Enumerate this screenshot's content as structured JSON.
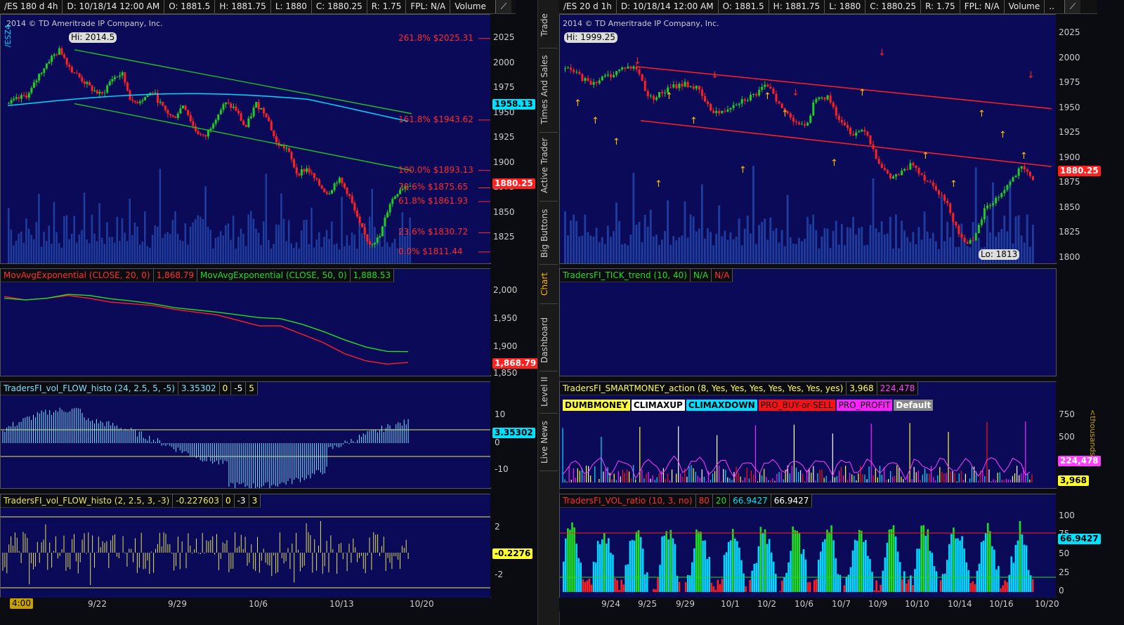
{
  "left": {
    "header": [
      "/ES 180 d 4h",
      "D: 10/18/14 12:00 AM",
      "O: 1881.5",
      "H: 1881.75",
      "L: 1880",
      "C: 1880.25",
      "R: 1.75",
      "FPL: N/A",
      "Volume",
      "..."
    ],
    "copyright": "2014 © TD Ameritrade IP Company, Inc.",
    "contract_label": "/ESZ4",
    "hi_label": "Hi: 2014.5",
    "price_ticks": [
      "2025",
      "2000",
      "1975",
      "1950",
      "1925",
      "1900",
      "1875",
      "1850",
      "1825"
    ],
    "price_badge": "1880.25",
    "ema_badge": "1958.13",
    "fib_levels": [
      {
        "pct": "261.8%",
        "price": "$2025.31"
      },
      {
        "pct": "161.8%",
        "price": "$1943.62"
      },
      {
        "pct": "100.0%",
        "price": "$1893.13"
      },
      {
        "pct": "78.6%",
        "price": "$1875.65"
      },
      {
        "pct": "61.8%",
        "price": "$1861.93"
      },
      {
        "pct": "23.6%",
        "price": "$1830.72"
      },
      {
        "pct": "0.0%",
        "price": "$1811.44"
      }
    ],
    "ma_study": {
      "label1": "MovAvgExponential (CLOSE, 20, 0)",
      "val1": "1,868.79",
      "label2": "MovAvgExponential (CLOSE, 50, 0)",
      "val2": "1,888.53"
    },
    "ma_ticks": [
      "2,000",
      "1,950",
      "1,900",
      "1,850"
    ],
    "ma_badge": "1,868.79",
    "flow1": {
      "label": "TradersFI_vol_FLOW_histo (24, 2.5, 5, -5)",
      "val": "3.35302",
      "p1": "0",
      "p2": "-5",
      "p3": "5"
    },
    "flow1_ticks": [
      "10",
      "0",
      "-10"
    ],
    "flow1_badge": "3.35302",
    "flow2": {
      "label": "TradersFI_vol_FLOW_histo (2, 2.5, 3, -3)",
      "val": "-0.227603",
      "p1": "0",
      "p2": "-3",
      "p3": "3"
    },
    "flow2_ticks": [
      "2",
      "-2"
    ],
    "flow2_badge": "-0.2276",
    "time_badge": "4:00",
    "x_labels": [
      "9/22",
      "9/29",
      "10/6",
      "10/13",
      "10/20"
    ]
  },
  "right": {
    "header": [
      "/ES 20 d 1h",
      "D: 10/18/14 12:00 AM",
      "O: 1881.5",
      "H: 1881.75",
      "L: 1880",
      "C: 1880.25",
      "R: 1.75",
      "FPL: N/A",
      "Volume",
      "..."
    ],
    "copyright": "2014 © TD Ameritrade IP Company, Inc.",
    "hi_label": "Hi: 1999.25",
    "lo_label": "Lo: 1813",
    "price_ticks": [
      "2025",
      "2000",
      "1975",
      "1950",
      "1925",
      "1900",
      "1875",
      "1850",
      "1825",
      "1800"
    ],
    "price_badge": "1880.25",
    "tick_study": {
      "label": "TradersFI_TICK_trend (10, 40)",
      "v1": "N/A",
      "v2": "N/A"
    },
    "smart_study": {
      "label": "TradersFI_SMARTMONEY_action (8, Yes, Yes, Yes, Yes, Yes, Yes, yes)",
      "v1": "3,968",
      "v2": "224,478"
    },
    "smart_legend": [
      "DUMBMONEY",
      "CLIMAXUP",
      "CLIMAXDOWN",
      "PRO_BUY-or-SELL",
      "PRO_PROFIT",
      "Default"
    ],
    "smart_ticks": [
      "750",
      "500",
      "250"
    ],
    "smart_unit": "<thousands>",
    "smart_badge1": "224,478",
    "smart_badge2": "3,968",
    "ratio_study": {
      "label": "TradersFI_VOL_ratio (10, 3, no)",
      "v1": "80",
      "v2": "20",
      "v3": "66.9427",
      "v4": "66.9427"
    },
    "ratio_ticks": [
      "100",
      "75",
      "50",
      "25",
      "0"
    ],
    "ratio_badge": "66.9427",
    "x_labels": [
      "9/24",
      "9/25",
      "9/29",
      "10/1",
      "10/2",
      "10/6",
      "10/7",
      "10/9",
      "10/10",
      "10/14",
      "10/16",
      "10/20"
    ]
  },
  "sidebar_tabs": [
    "Trade",
    "Times And Sales",
    "Active Trader",
    "Big Buttons",
    "Chart",
    "Dashboard",
    "Level II",
    "Live News"
  ],
  "colors": {
    "up": "#22cc22",
    "down": "#ff2020",
    "panel": "#0a0a59",
    "fib": "#ff2a2a",
    "ema": "#00d8ff",
    "channel_left": "#22cc22",
    "channel_right": "#ff2020",
    "hist": "#7fe0ff",
    "hist2": "#e0e060",
    "volume": "#1f3d9e"
  },
  "chart_data": [
    {
      "type": "candlestick",
      "title": "/ES 180 d 4h",
      "ylim": [
        1800,
        2035
      ],
      "hi": 2014.5,
      "last": 1880.25,
      "close_path": [
        1960,
        1965,
        1970,
        1990,
        2005,
        2014,
        1995,
        1985,
        1975,
        1968,
        1985,
        1990,
        1960,
        1965,
        1972,
        1955,
        1945,
        1960,
        1935,
        1925,
        1945,
        1960,
        1955,
        1935,
        1960,
        1950,
        1920,
        1915,
        1890,
        1895,
        1880,
        1870,
        1885,
        1870,
        1840,
        1820,
        1825,
        1860,
        1875,
        1880
      ]
    },
    {
      "type": "line",
      "title": "MovAvgExponential",
      "series": [
        {
          "name": "MovAvgExponential (CLOSE, 20, 0)",
          "values": [
            1988,
            1982,
            1985,
            1990,
            1985,
            1978,
            1975,
            1972,
            1965,
            1960,
            1955,
            1945,
            1935,
            1935,
            1920,
            1905,
            1885,
            1872,
            1866,
            1869
          ]
        },
        {
          "name": "MovAvgExponential (CLOSE, 50, 0)",
          "values": [
            1985,
            1982,
            1985,
            1992,
            1990,
            1984,
            1980,
            1975,
            1968,
            1964,
            1960,
            1955,
            1950,
            1948,
            1938,
            1925,
            1910,
            1897,
            1889,
            1888.5
          ]
        }
      ]
    },
    {
      "type": "bar",
      "title": "TradersFI_vol_FLOW_histo (24, 2.5, 5, -5)",
      "last": 3.35302
    },
    {
      "type": "bar",
      "title": "TradersFI_vol_FLOW_histo (2, 2.5, 3, -3)",
      "last": -0.227603
    },
    {
      "type": "candlestick",
      "title": "/ES 20 d 1h",
      "ylim": [
        1795,
        2030
      ],
      "hi": 1999.25,
      "lo": 1813,
      "last": 1880.25,
      "close_path": [
        1990,
        1985,
        1975,
        1980,
        1985,
        1992,
        1990,
        1960,
        1965,
        1972,
        1975,
        1970,
        1950,
        1945,
        1955,
        1960,
        1965,
        1975,
        1950,
        1940,
        1930,
        1965,
        1960,
        1935,
        1925,
        1930,
        1900,
        1880,
        1885,
        1895,
        1880,
        1870,
        1850,
        1820,
        1815,
        1850,
        1860,
        1875,
        1890,
        1880
      ]
    },
    {
      "type": "bar",
      "title": "TradersFI_SMARTMONEY_action",
      "last": [
        3968,
        224478
      ]
    },
    {
      "type": "area",
      "title": "TradersFI_VOL_ratio (10, 3, no)",
      "ylim": [
        0,
        100
      ],
      "levels": [
        80,
        20
      ],
      "last": 66.9427
    }
  ]
}
